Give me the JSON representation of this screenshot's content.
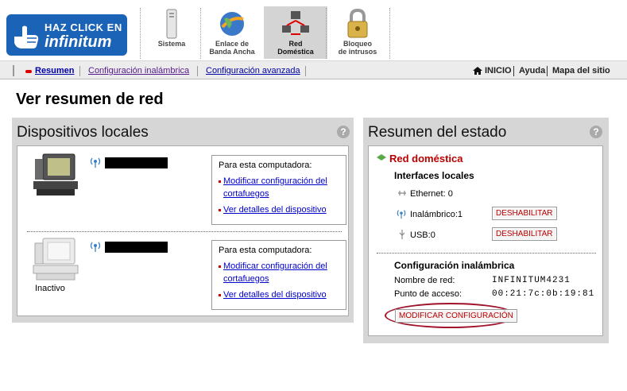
{
  "logo": {
    "line1": "HAZ CLICK EN",
    "line2": "infinitum"
  },
  "nav_tabs": [
    {
      "label1": "Sistema",
      "label2": ""
    },
    {
      "label1": "Enlace de",
      "label2": "Banda Ancha"
    },
    {
      "label1": "Red",
      "label2": "Doméstica"
    },
    {
      "label1": "Bloqueo",
      "label2": "de intrusos"
    }
  ],
  "subnav": {
    "resumen": "Resumen",
    "inalambrica": "Configuración inalámbrica",
    "avanzada": "Configuración avanzada",
    "inicio": "INICIO",
    "ayuda": "Ayuda",
    "mapa": "Mapa del sitio"
  },
  "page_title": "Ver resumen de red",
  "local_devices": {
    "title": "Dispositivos locales",
    "help": "?",
    "devices": [
      {
        "status": "",
        "box_title": "Para esta computadora:",
        "link1a": "Modificar configuración del",
        "link1b": "cortafuegos",
        "link2": "Ver detalles del dispositivo"
      },
      {
        "status": "Inactivo",
        "box_title": "Para esta computadora:",
        "link1a": "Modificar configuración del",
        "link1b": "cortafuegos",
        "link2": "Ver detalles del dispositivo"
      }
    ]
  },
  "status_summary": {
    "title": "Resumen del estado",
    "help": "?",
    "network": "Red doméstica",
    "interfaces_title": "Interfaces locales",
    "ethernet_label": "Ethernet:",
    "ethernet_value": "0",
    "wireless_label": "Inalámbrico:",
    "wireless_value": "1",
    "usb_label": "USB:",
    "usb_value": "0",
    "disable_btn": "DESHABILITAR",
    "wireless_config_title": "Configuración inalámbrica",
    "ssid_label": "Nombre de red:",
    "ssid_value": "INFINITUM4231",
    "ap_label": "Punto de acceso:",
    "ap_value": "00:21:7c:0b:19:81",
    "modify_btn": "MODIFICAR CONFIGURACIÓN"
  },
  "colors": {
    "brand_blue": "#1a63b6",
    "panel_gray": "#d6d6d6",
    "link_blue": "#0000cc",
    "alert_red": "#b00000",
    "highlight_ring": "#a0122a"
  }
}
